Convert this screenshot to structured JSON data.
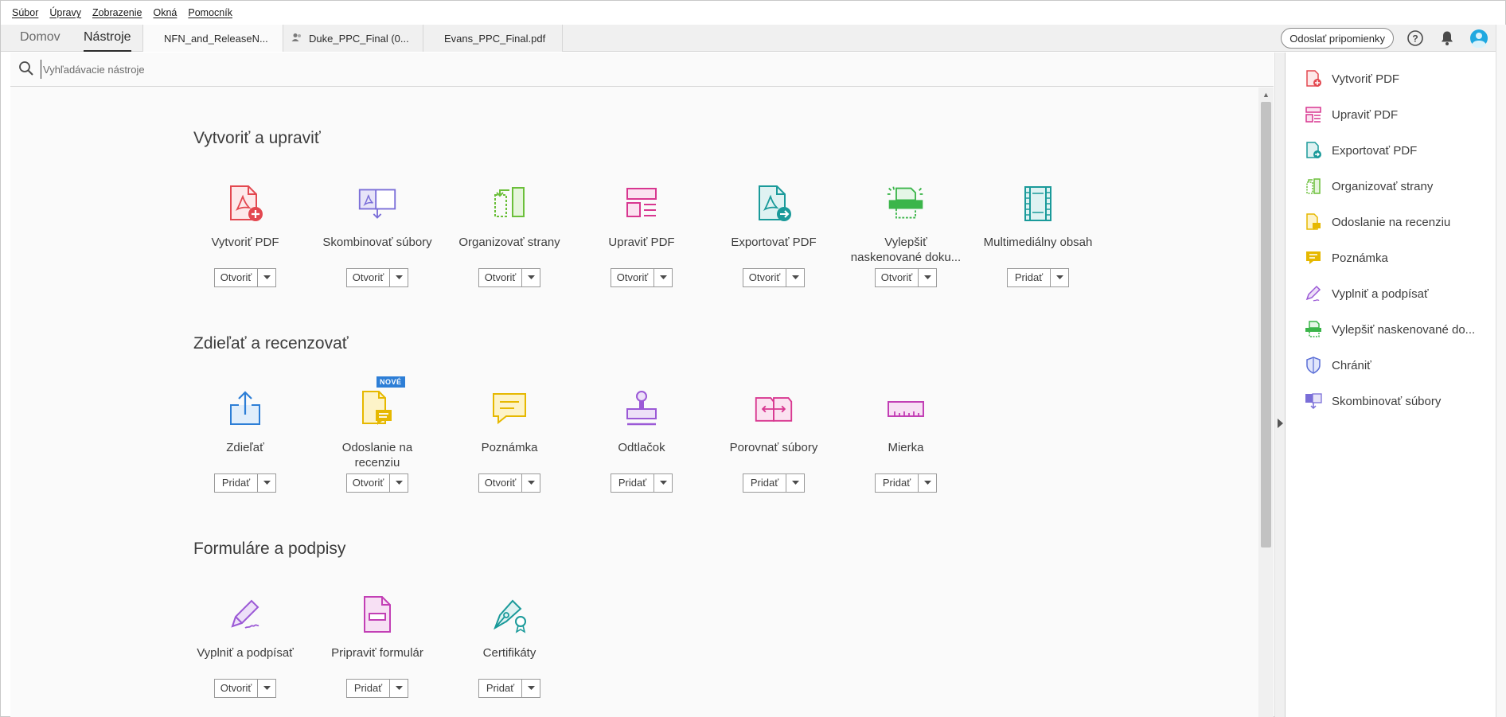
{
  "menubar": {
    "items": [
      "Súbor",
      "Úpravy",
      "Zobrazenie",
      "Okná",
      "Pomocník"
    ]
  },
  "tabs": {
    "home": "Domov",
    "tools": "Nástroje",
    "docs": [
      "NFN_and_ReleaseN...",
      "Duke_PPC_Final (0...",
      "Evans_PPC_Final.pdf"
    ]
  },
  "toolbar": {
    "feedback": "Odoslať pripomienky"
  },
  "search": {
    "placeholder": "Vyhľadávacie nástroje"
  },
  "sections": {
    "create": {
      "title": "Vytvoriť a upraviť",
      "tools": [
        {
          "label": "Vytvoriť PDF",
          "action": "Otvoriť",
          "icon": "create-pdf-icon"
        },
        {
          "label": "Skombinovať súbory",
          "action": "Otvoriť",
          "icon": "combine-files-icon"
        },
        {
          "label": "Organizovať strany",
          "action": "Otvoriť",
          "icon": "organize-pages-icon"
        },
        {
          "label": "Upraviť PDF",
          "action": "Otvoriť",
          "icon": "edit-pdf-icon"
        },
        {
          "label": "Exportovať PDF",
          "action": "Otvoriť",
          "icon": "export-pdf-icon"
        },
        {
          "label": "Vylepšiť naskenované doku...",
          "action": "Otvoriť",
          "icon": "enhance-scan-icon"
        },
        {
          "label": "Multimediálny obsah",
          "action": "Pridať",
          "icon": "rich-media-icon"
        }
      ]
    },
    "share": {
      "title": "Zdieľať a recenzovať",
      "badge": "NOVÉ",
      "tools": [
        {
          "label": "Zdieľať",
          "action": "Pridať",
          "icon": "share-icon"
        },
        {
          "label": "Odoslanie na recenziu",
          "action": "Otvoriť",
          "icon": "send-review-icon"
        },
        {
          "label": "Poznámka",
          "action": "Otvoriť",
          "icon": "comment-icon"
        },
        {
          "label": "Odtlačok",
          "action": "Pridať",
          "icon": "stamp-icon"
        },
        {
          "label": "Porovnať súbory",
          "action": "Pridať",
          "icon": "compare-files-icon"
        },
        {
          "label": "Mierka",
          "action": "Pridať",
          "icon": "measure-icon"
        }
      ]
    },
    "forms": {
      "title": "Formuláre a podpisy",
      "tools": [
        {
          "label": "Vyplniť a podpísať",
          "action": "Otvoriť",
          "icon": "fill-sign-icon"
        },
        {
          "label": "Pripraviť formulár",
          "action": "Pridať",
          "icon": "prepare-form-icon"
        },
        {
          "label": "Certifikáty",
          "action": "Pridať",
          "icon": "certificates-icon"
        }
      ]
    }
  },
  "right_panel": {
    "items": [
      {
        "label": "Vytvoriť PDF",
        "icon": "create-pdf-icon"
      },
      {
        "label": "Upraviť PDF",
        "icon": "edit-pdf-icon"
      },
      {
        "label": "Exportovať PDF",
        "icon": "export-pdf-icon"
      },
      {
        "label": "Organizovať strany",
        "icon": "organize-pages-icon"
      },
      {
        "label": "Odoslanie na recenziu",
        "icon": "send-review-icon"
      },
      {
        "label": "Poznámka",
        "icon": "comment-icon"
      },
      {
        "label": "Vyplniť a podpísať",
        "icon": "fill-sign-icon"
      },
      {
        "label": "Vylepšiť naskenované do...",
        "icon": "enhance-scan-icon"
      },
      {
        "label": "Chrániť",
        "icon": "protect-icon"
      },
      {
        "label": "Skombinovať súbory",
        "icon": "combine-files-icon"
      }
    ]
  },
  "colors": {
    "red": "#e34850",
    "purple": "#7a6ed8",
    "green": "#6bbf3a",
    "pink": "#d83790",
    "teal": "#1a9a9a",
    "yellow": "#e6b800",
    "blue": "#2d7ed6",
    "violet": "#9b59d6"
  }
}
